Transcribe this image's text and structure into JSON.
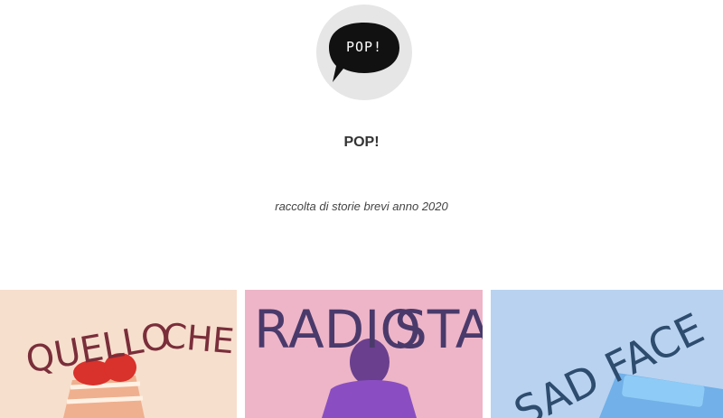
{
  "profile": {
    "logo_text": "POP!",
    "title": "POP!",
    "subtitle": "raccolta di storie brevi anno 2020"
  },
  "cards": [
    {
      "title_word1": "QUELLO",
      "title_word2": "CHE",
      "bg": "#f6dfcd"
    },
    {
      "title_word1": "RADIO",
      "title_word2": "STAR",
      "bg": "#eeb5c8"
    },
    {
      "title_word1": "SAD FACE",
      "bg": "#b9d2f0"
    }
  ]
}
